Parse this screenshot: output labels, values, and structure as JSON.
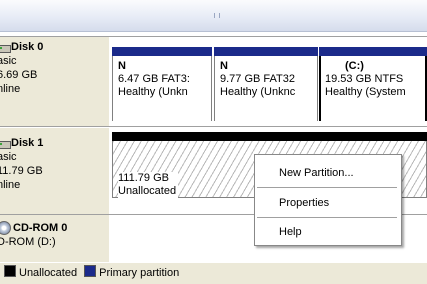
{
  "legend": {
    "items": [
      {
        "label": "Unallocated",
        "color": "#000000"
      },
      {
        "label": "Primary partition",
        "color": "#1b2a8a"
      }
    ]
  },
  "disks": [
    {
      "name": "Disk 0",
      "type": "asic",
      "size": "6.69 GB",
      "status": "nline",
      "icon": "hard-drive-icon"
    },
    {
      "name": "Disk 1",
      "type": "asic",
      "size": "11.79 GB",
      "status": "nline",
      "icon": "hard-drive-icon"
    },
    {
      "name": "CD-ROM 0",
      "type": "D-ROM (D:)",
      "icon": "cd-drive-icon"
    }
  ],
  "partitions": [
    {
      "title": "N",
      "size": "6.47 GB FAT3:",
      "status": "Healthy (Unkn"
    },
    {
      "title": "N",
      "size": "9.77 GB FAT32",
      "status": "Healthy (Unknc"
    },
    {
      "title": "(C:)",
      "size": "19.53 GB NTFS",
      "status": "Healthy (System"
    }
  ],
  "unallocated": {
    "size": "111.79 GB",
    "label": "Unallocated"
  },
  "context_menu": {
    "items": [
      "New Partition...",
      "Properties",
      "Help"
    ]
  },
  "colors": {
    "primary_partition": "#1b2a8a",
    "unallocated": "#000000",
    "panel": "#ece9d8"
  }
}
